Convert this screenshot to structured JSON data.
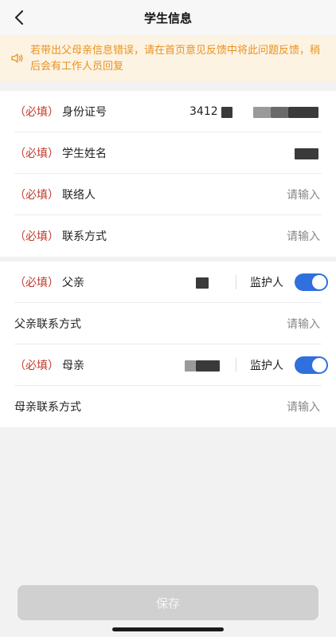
{
  "navbar": {
    "title": "学生信息",
    "back_icon": "chevron-left-icon"
  },
  "notice": {
    "icon": "speaker-icon",
    "text": "若带出父母亲信息错误，请在首页意见反馈中将此问题反馈，稍后会有工作人员回复"
  },
  "required_tag": "（必填）",
  "fields": {
    "id_number": {
      "label": "身份证号",
      "value_prefix": "3412"
    },
    "student_name": {
      "label": "学生姓名"
    },
    "contact_person": {
      "label": "联络人",
      "placeholder": "请输入"
    },
    "contact_method": {
      "label": "联系方式",
      "placeholder": "请输入"
    },
    "father": {
      "label": "父亲",
      "guardian_label": "监护人",
      "guardian_on": true
    },
    "father_contact": {
      "label": "父亲联系方式",
      "placeholder": "请输入"
    },
    "mother": {
      "label": "母亲",
      "guardian_label": "监护人",
      "guardian_on": true
    },
    "mother_contact": {
      "label": "母亲联系方式",
      "placeholder": "请输入"
    }
  },
  "colors": {
    "accent": "#2f6fde",
    "required": "#c0392b",
    "notice_text": "#e8921f",
    "notice_bg": "#fdf3e3"
  },
  "footer": {
    "save_label": "保存"
  }
}
